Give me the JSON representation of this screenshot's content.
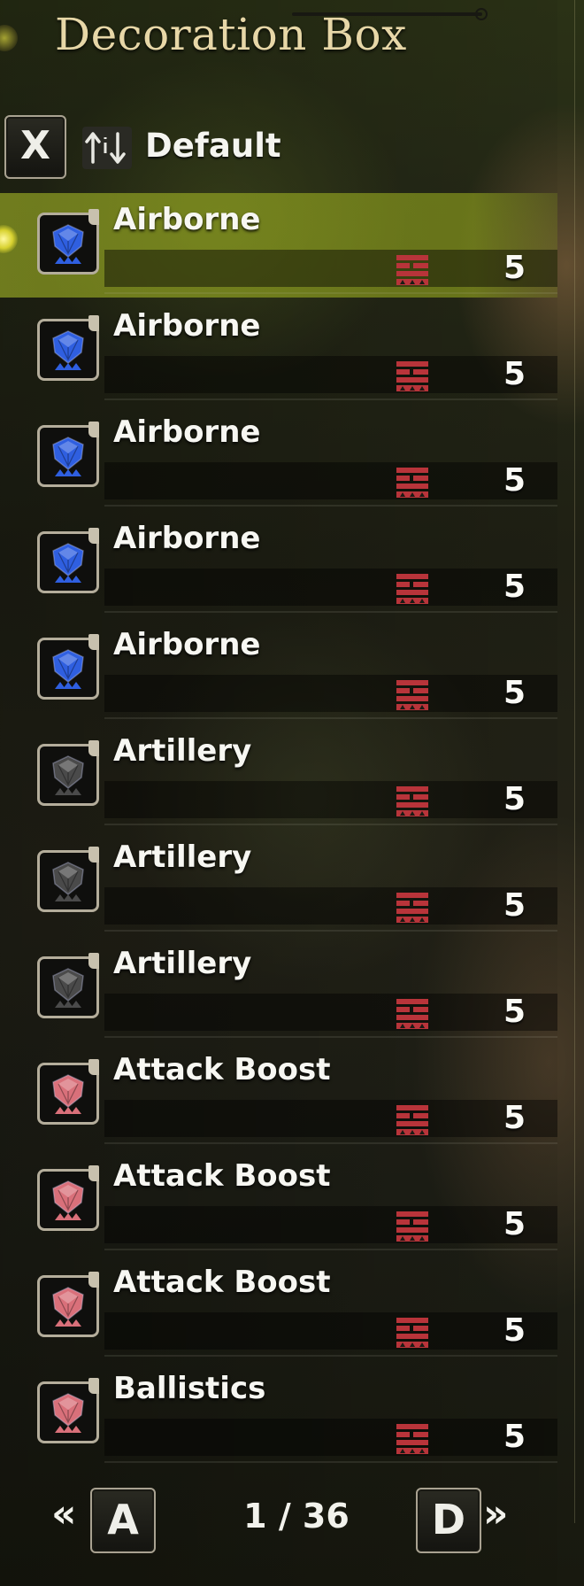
{
  "title": "Decoration Box",
  "sort": {
    "key": "X",
    "label": "Default"
  },
  "decorations": [
    {
      "name": "Airborne",
      "quantity": "5",
      "gem_color": "#2f5fe0",
      "selected": true
    },
    {
      "name": "Airborne",
      "quantity": "5",
      "gem_color": "#2f5fe0",
      "selected": false
    },
    {
      "name": "Airborne",
      "quantity": "5",
      "gem_color": "#2f5fe0",
      "selected": false
    },
    {
      "name": "Airborne",
      "quantity": "5",
      "gem_color": "#2f5fe0",
      "selected": false
    },
    {
      "name": "Airborne",
      "quantity": "5",
      "gem_color": "#2f5fe0",
      "selected": false
    },
    {
      "name": "Artillery",
      "quantity": "5",
      "gem_color": "#4a4a4a",
      "selected": false
    },
    {
      "name": "Artillery",
      "quantity": "5",
      "gem_color": "#4a4a4a",
      "selected": false
    },
    {
      "name": "Artillery",
      "quantity": "5",
      "gem_color": "#4a4a4a",
      "selected": false
    },
    {
      "name": "Attack Boost",
      "quantity": "5",
      "gem_color": "#d9707a",
      "selected": false
    },
    {
      "name": "Attack Boost",
      "quantity": "5",
      "gem_color": "#d9707a",
      "selected": false
    },
    {
      "name": "Attack Boost",
      "quantity": "5",
      "gem_color": "#d9707a",
      "selected": false
    },
    {
      "name": "Ballistics",
      "quantity": "5",
      "gem_color": "#d9707a",
      "selected": false
    }
  ],
  "slot_icon_color": "#b8343a",
  "pagination": {
    "prev_key": "A",
    "next_key": "D",
    "page_text": "1 / 36",
    "prev_chevron": "«",
    "next_chevron": "»"
  }
}
